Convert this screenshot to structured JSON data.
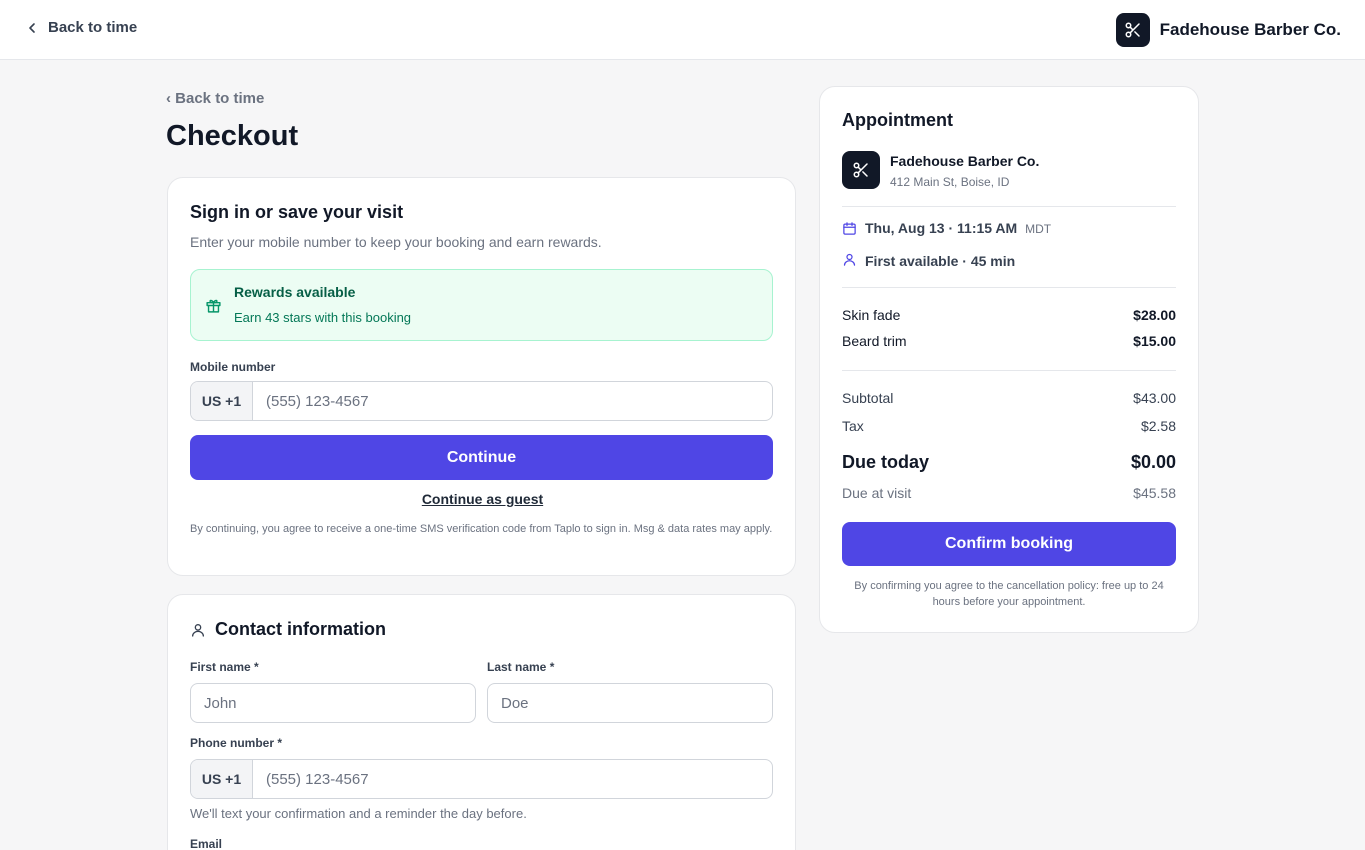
{
  "topbar": {
    "back_label": "Back to time",
    "brand_name": "Fadehouse Barber Co."
  },
  "page": {
    "back_label": "‹ Back to time",
    "title": "Checkout"
  },
  "signin": {
    "title": "Sign in or save your visit",
    "subtitle": "Enter your mobile number to keep your booking and earn rewards.",
    "rewards_title": "Rewards available",
    "rewards_text": "Earn 43 stars with this booking",
    "mobile_label": "Mobile number",
    "country_code": "US +1",
    "mobile_placeholder": "(555) 123-4567",
    "continue_label": "Continue",
    "guest_label": "Continue as guest",
    "disclaimer": "By continuing, you agree to receive a one-time SMS verification code from Taplo to sign in. Msg & data rates may apply."
  },
  "contact": {
    "title": "Contact information",
    "first_name_label": "First name *",
    "first_name_placeholder": "John",
    "last_name_label": "Last name *",
    "last_name_placeholder": "Doe",
    "phone_label": "Phone number *",
    "country_code": "US +1",
    "phone_placeholder": "(555) 123-4567",
    "phone_help": "We'll text your confirmation and a reminder the day before.",
    "email_label": "Email"
  },
  "appointment": {
    "title": "Appointment",
    "shop_name": "Fadehouse Barber Co.",
    "shop_address": "412 Main St, Boise, ID",
    "datetime": "Thu, Aug 13 · 11:15 AM",
    "timezone": "MDT",
    "barber": "First available · 45 min",
    "services": [
      {
        "name": "Skin fade",
        "price": "$28.00"
      },
      {
        "name": "Beard trim",
        "price": "$15.00"
      }
    ],
    "subtotal_label": "Subtotal",
    "subtotal": "$43.00",
    "tax_label": "Tax",
    "tax": "$2.58",
    "due_today_label": "Due today",
    "due_today": "$0.00",
    "due_visit_label": "Due at visit",
    "due_visit": "$45.58",
    "confirm_label": "Confirm booking",
    "policy": "By confirming you agree to the cancellation policy: free up to 24 hours before your appointment."
  },
  "colors": {
    "accent": "#4f46e5",
    "rewards_bg": "#ecfdf3",
    "rewards_text": "#065f46"
  }
}
